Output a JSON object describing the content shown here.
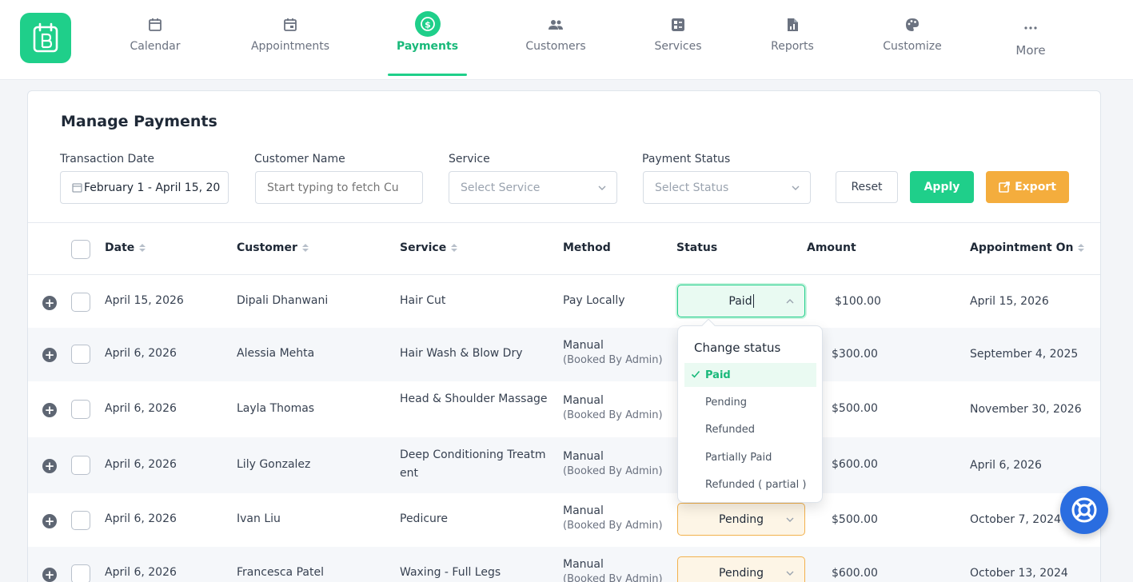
{
  "nav": {
    "items": [
      {
        "label": "Calendar",
        "icon": "calendar-icon"
      },
      {
        "label": "Appointments",
        "icon": "calendar-check-icon"
      },
      {
        "label": "Payments",
        "icon": "dollar-icon",
        "active": true
      },
      {
        "label": "Customers",
        "icon": "users-icon"
      },
      {
        "label": "Services",
        "icon": "services-icon"
      },
      {
        "label": "Reports",
        "icon": "report-icon"
      },
      {
        "label": "Customize",
        "icon": "palette-icon"
      },
      {
        "label": "More",
        "icon": "dots-icon"
      }
    ]
  },
  "page": {
    "title": "Manage Payments"
  },
  "filters": {
    "date_label": "Transaction Date",
    "date_value": "February 1  -  April 15, 20",
    "customer_label": "Customer Name",
    "customer_placeholder": "Start typing to fetch Cu",
    "service_label": "Service",
    "service_placeholder": "Select Service",
    "status_label": "Payment Status",
    "status_placeholder": "Select Status",
    "reset": "Reset",
    "apply": "Apply",
    "export": "Export"
  },
  "table": {
    "headers": {
      "date": "Date",
      "customer": "Customer",
      "service": "Service",
      "method": "Method",
      "status": "Status",
      "amount": "Amount",
      "appointment_on": "Appointment On"
    },
    "rows": [
      {
        "date": "April 15, 2026",
        "customer": "Dipali Dhanwani",
        "service": "Hair Cut",
        "method": "Pay Locally",
        "method_sub": "",
        "status": "Paid",
        "amount": "$100.00",
        "appointment_on": "April 15, 2026"
      },
      {
        "date": "April 6, 2026",
        "customer": "Alessia Mehta",
        "service": "Hair Wash & Blow Dry",
        "method": "Manual",
        "method_sub": "(Booked By Admin)",
        "status": "",
        "amount": "$300.00",
        "appointment_on": "September 4, 2025"
      },
      {
        "date": "April 6, 2026",
        "customer": "Layla Thomas",
        "service": "Head & Shoulder Massage",
        "method": "Manual",
        "method_sub": "(Booked By Admin)",
        "status": "",
        "amount": "$500.00",
        "appointment_on": "November 30, 2026"
      },
      {
        "date": "April 6, 2026",
        "customer": "Lily Gonzalez",
        "service": "Deep Conditioning Treatment",
        "method": "Manual",
        "method_sub": "(Booked By Admin)",
        "status": "",
        "amount": "$600.00",
        "appointment_on": "April 6, 2026"
      },
      {
        "date": "April 6, 2026",
        "customer": "Ivan Liu",
        "service": "Pedicure",
        "method": "Manual",
        "method_sub": "(Booked By Admin)",
        "status": "Pending",
        "amount": "$500.00",
        "appointment_on": "October 7, 2024"
      },
      {
        "date": "April 6, 2026",
        "customer": "Francesca Patel",
        "service": "Waxing - Full Legs",
        "method": "Manual",
        "method_sub": "(Booked By Admin)",
        "status": "Pending",
        "amount": "$600.00",
        "appointment_on": "October 13, 2024"
      }
    ]
  },
  "status_dropdown": {
    "title": "Change status",
    "options": [
      "Paid",
      "Pending",
      "Refunded",
      "Partially Paid",
      "Refunded ( partial )"
    ],
    "selected": "Paid"
  },
  "colors": {
    "accent": "#1fcf8a",
    "export": "#f4ad3d",
    "pending_border": "#f2b14d",
    "help": "#2a6de0"
  }
}
